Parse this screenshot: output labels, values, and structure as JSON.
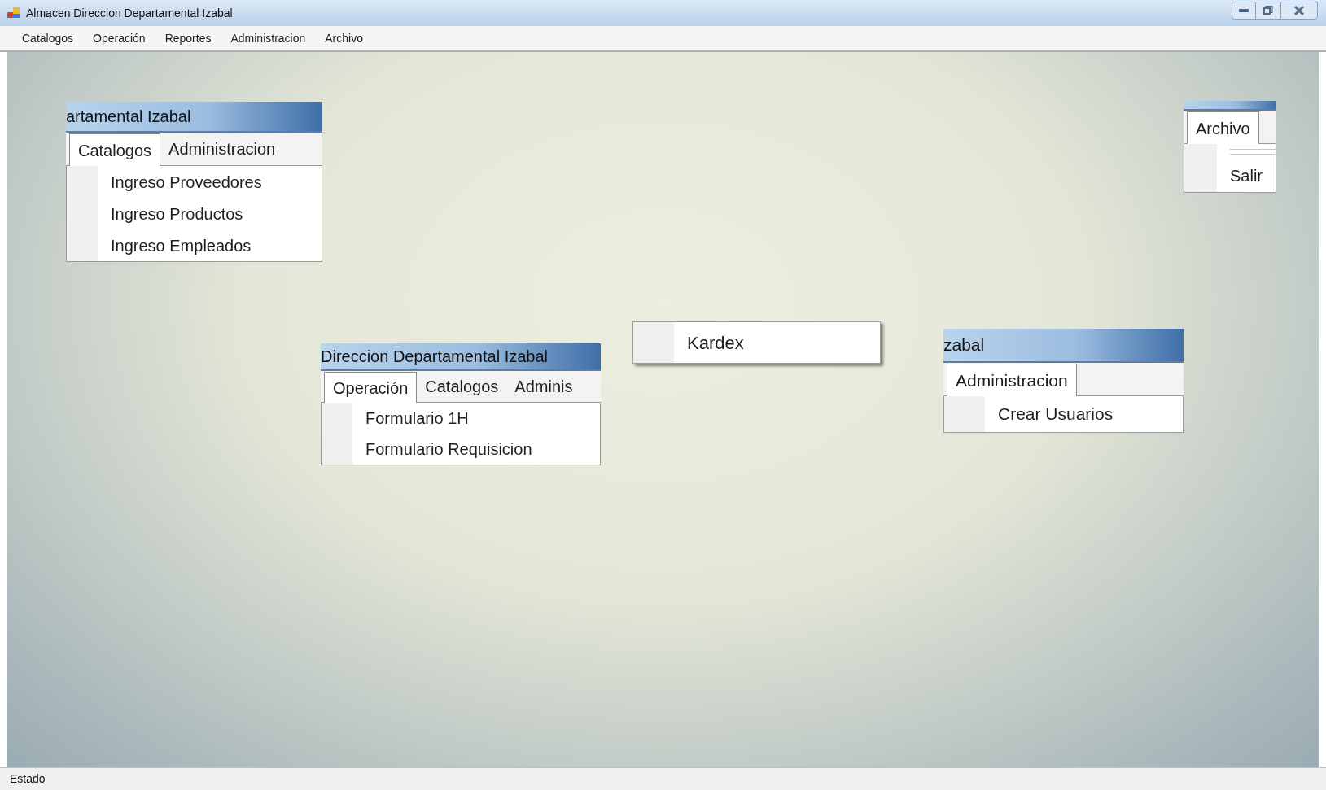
{
  "window": {
    "title": "Almacen Direccion Departamental Izabal"
  },
  "menu_bar": [
    "Catalogos",
    "Operación",
    "Reportes",
    "Administracion",
    "Archivo"
  ],
  "captures": [
    {
      "kind": "window",
      "title": "artamental Izabal",
      "tabs": [
        {
          "label": "Catalogos",
          "selected": true
        },
        {
          "label": "Administracion",
          "selected": false
        }
      ],
      "items": [
        {
          "kind": "item",
          "label": "Ingreso Proveedores"
        },
        {
          "kind": "item",
          "label": "Ingreso Productos"
        },
        {
          "kind": "item",
          "label": "Ingreso Empleados"
        }
      ]
    },
    {
      "kind": "window",
      "title": "Direccion Departamental Izabal",
      "tabs": [
        {
          "label": "Operación",
          "selected": true
        },
        {
          "label": "Catalogos",
          "selected": false
        },
        {
          "label": "Adminis",
          "selected": false
        }
      ],
      "items": [
        {
          "kind": "item",
          "label": "Formulario 1H"
        },
        {
          "kind": "item",
          "label": "Formulario Requisicion"
        }
      ]
    },
    {
      "kind": "dropdown",
      "items": [
        {
          "kind": "item",
          "label": "Kardex"
        }
      ]
    },
    {
      "kind": "window",
      "title": "zabal",
      "tabs": [
        {
          "label": "Administracion",
          "selected": true
        }
      ],
      "items": [
        {
          "kind": "item",
          "label": "Crear Usuarios"
        }
      ]
    },
    {
      "kind": "window",
      "tabs": [
        {
          "label": "Archivo",
          "selected": true
        }
      ],
      "items": [
        {
          "kind": "separator"
        },
        {
          "kind": "item",
          "label": "Salir"
        }
      ]
    }
  ],
  "status_bar": {
    "text": "Estado"
  }
}
